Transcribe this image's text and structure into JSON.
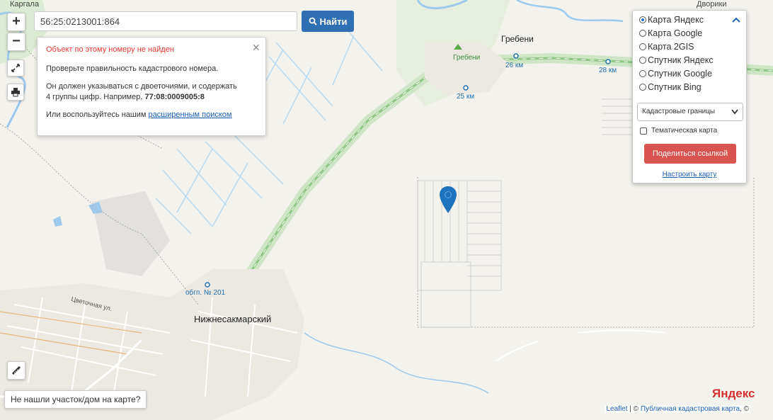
{
  "map": {
    "labels": {
      "kargala": "Каргала",
      "dvoriki": "Дворики",
      "grebeni_town": "Гребени",
      "grebeni_station": "Гребени",
      "km26": "26 км",
      "km28": "28 км",
      "km25": "25 км",
      "platform201": "обгп. № 201",
      "nizhnesakmarsky": "Нижнесакмарский",
      "tsvetochnaya": "Цветочная ул."
    }
  },
  "controls": {
    "zoom_in": "+",
    "zoom_out": "−",
    "fullscreen_icon": "expand-icon",
    "print_icon": "print-icon",
    "ruler_icon": "ruler-icon"
  },
  "search": {
    "value": "56:25:0213001:864",
    "button_label": "Найти",
    "button_icon": "search-icon"
  },
  "popup": {
    "error": "Объект по этому номеру не найден",
    "line1": "Проверьте правильность кадастрового номера.",
    "line2_a": "Он должен указываться с двоеточиями, и содержать",
    "line2_b": "4 группы цифр. Например, ",
    "example": "77:08:0009005:8",
    "line3_prefix": "Или воспользуйтесь нашим ",
    "advanced_link": "расширенным поиском",
    "close": "×"
  },
  "layers": {
    "options": [
      {
        "label": "Карта Яндекс",
        "selected": true
      },
      {
        "label": "Карта Google",
        "selected": false
      },
      {
        "label": "Карта 2GIS",
        "selected": false
      },
      {
        "label": "Спутник Яндекс",
        "selected": false
      },
      {
        "label": "Спутник Google",
        "selected": false
      },
      {
        "label": "Спутник Bing",
        "selected": false
      }
    ],
    "collapse": "^",
    "overlay_select": "Кадастровые границы",
    "thematic_label": "Тематическая карта",
    "share_button": "Поделиться ссылкой",
    "configure_link": "Настроить карту"
  },
  "bottom": {
    "not_found_button": "Не нашли участок/дом на карте?",
    "yandex_logo": "Яндекс",
    "attribution_leaflet": "Leaflet",
    "attribution_sep": " | © ",
    "attribution_pkk": "Публичная кадастровая карта",
    "attribution_tail": ", ©"
  },
  "colors": {
    "search_button": "#2f6fb3",
    "share_button": "#d9534f",
    "error_text": "#e53935",
    "marker": "#1e73be",
    "rail_green": "#a8d5a0",
    "water": "#9ec9ea"
  }
}
